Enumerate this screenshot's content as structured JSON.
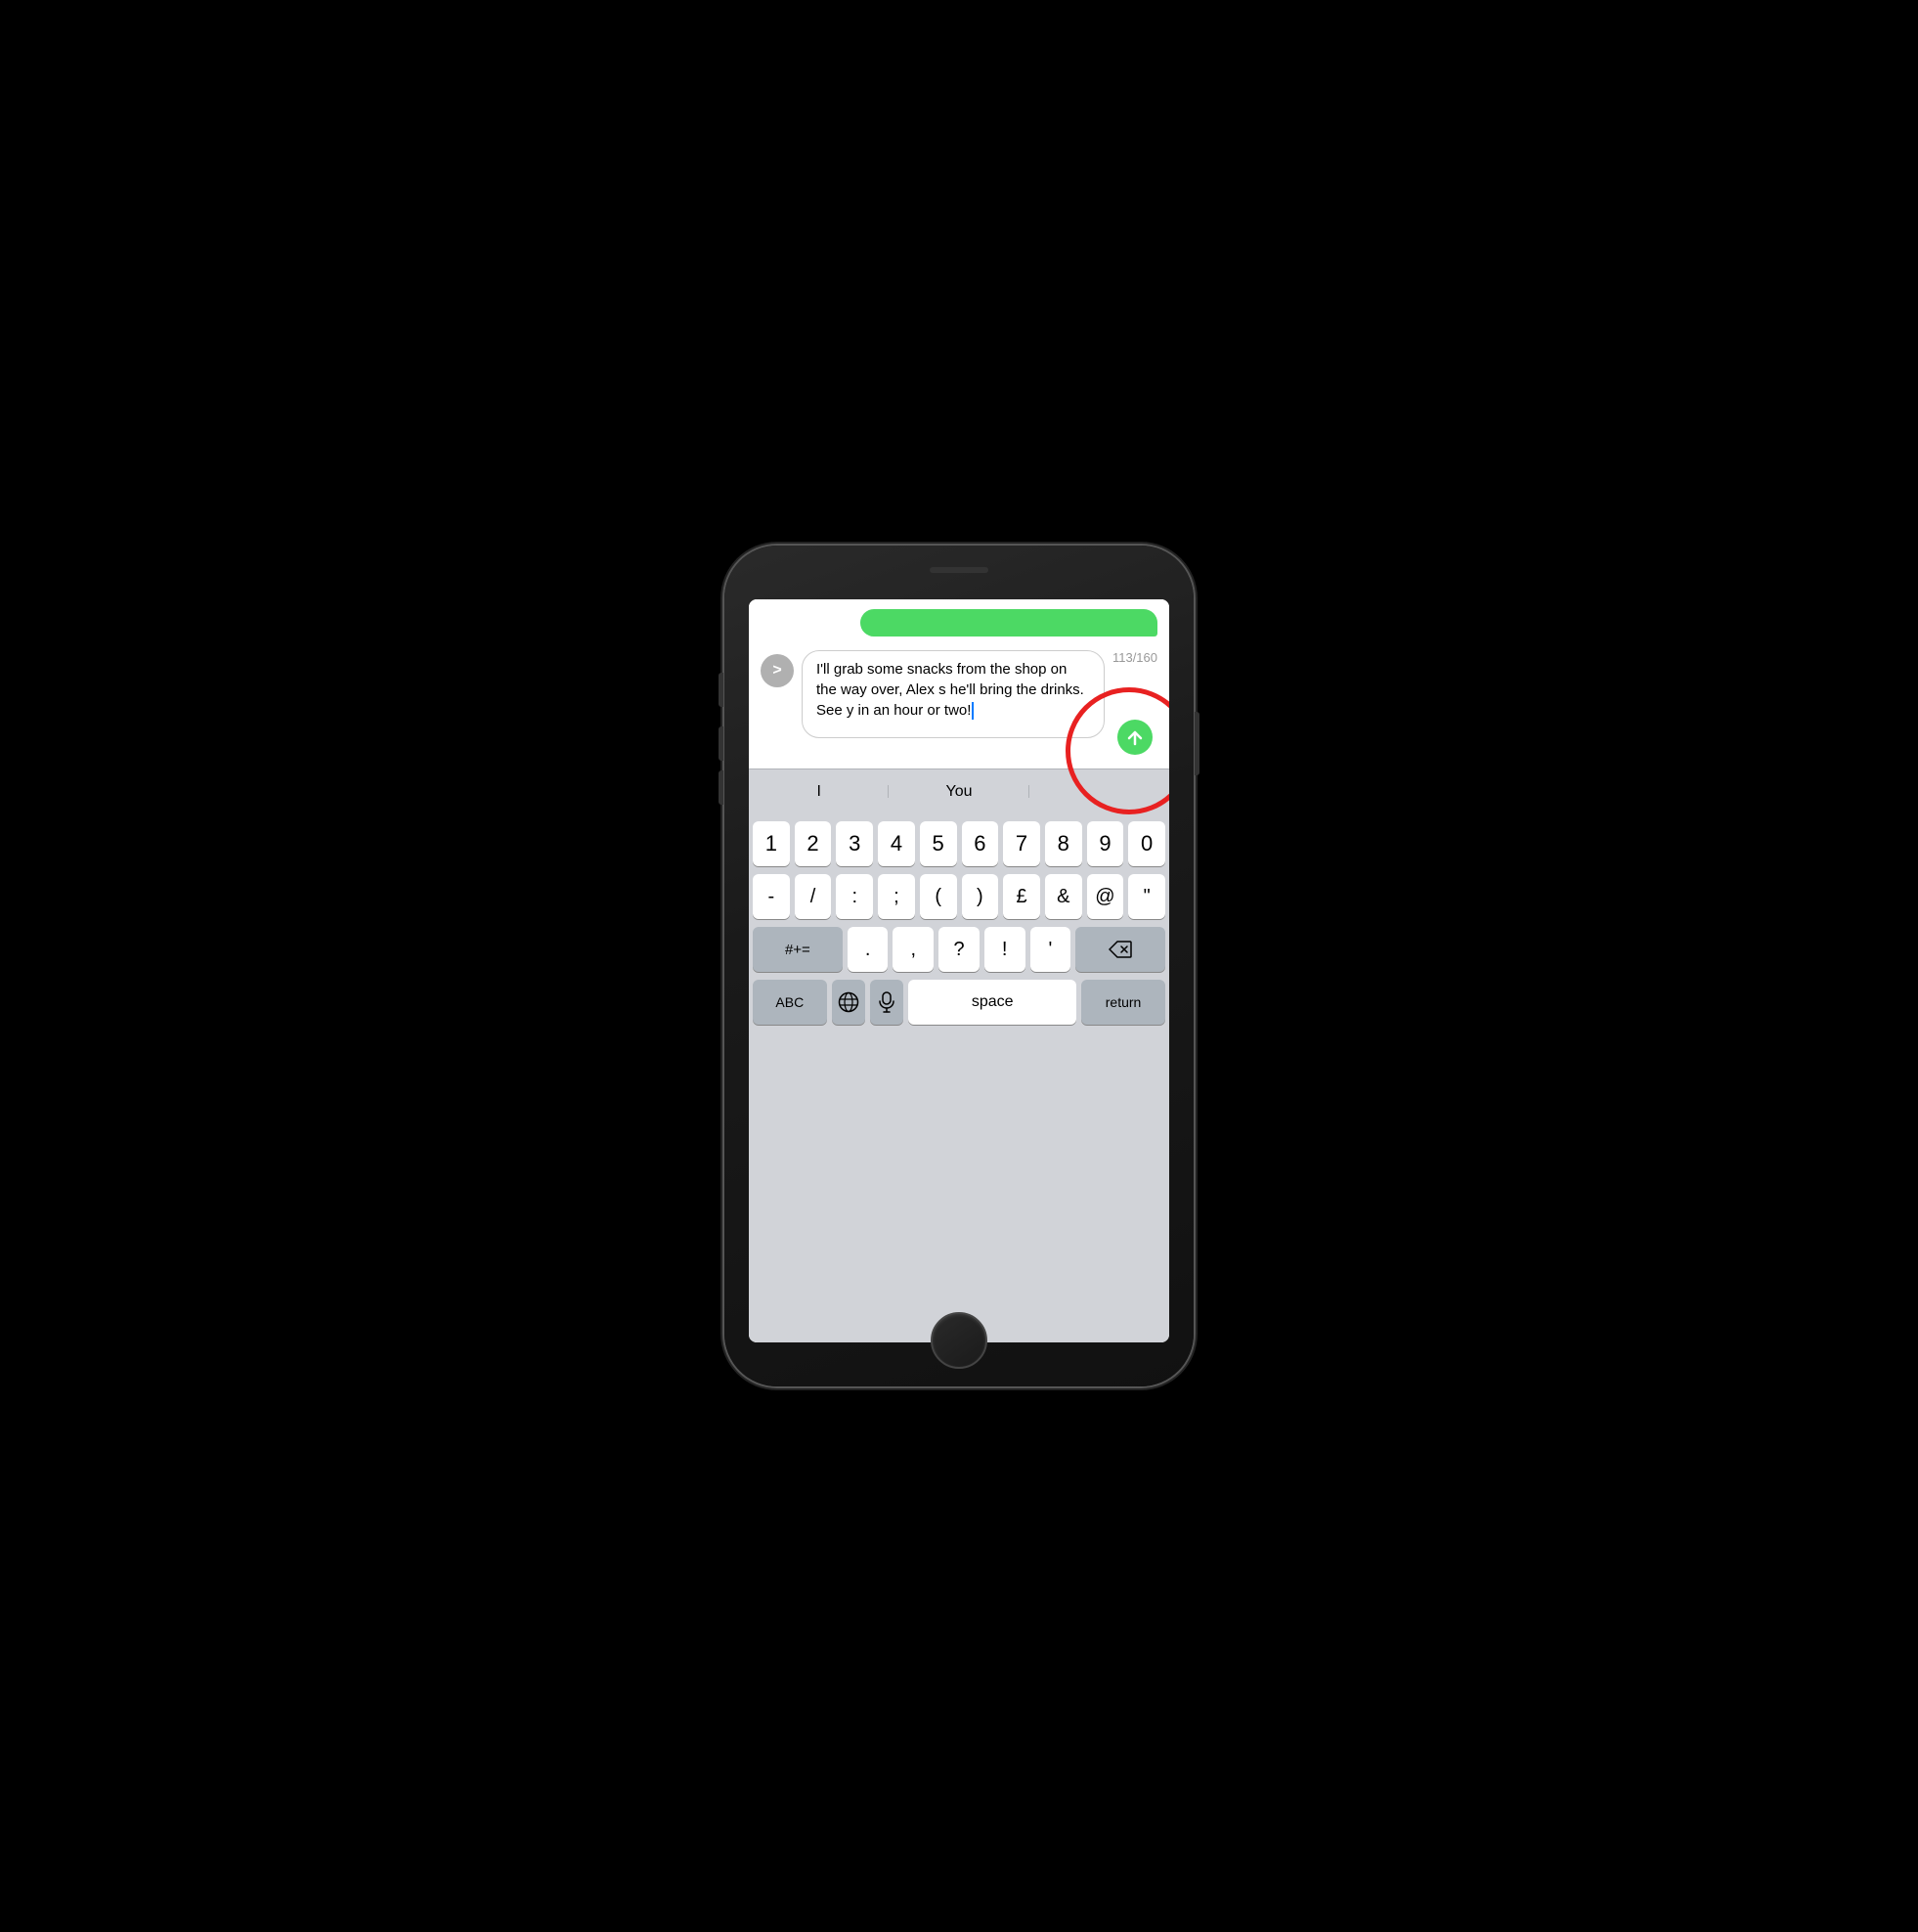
{
  "phone": {
    "screen": {
      "green_bubble_placeholder": "",
      "input": {
        "text": "I'll grab some snacks from the shop on the way over, Alex s he'll bring the drinks. See y in an hour or two!",
        "char_count": "113/160"
      },
      "expand_btn": ">",
      "send_btn_label": "↑",
      "autocomplete": {
        "left": "I",
        "middle": "You",
        "right": ""
      },
      "keyboard": {
        "row1": [
          "1",
          "2",
          "3",
          "4",
          "5",
          "6",
          "7",
          "8",
          "9",
          "0"
        ],
        "row2": [
          "-",
          "/",
          ":",
          ";",
          "(",
          ")",
          "£",
          "&",
          "@",
          "\""
        ],
        "row3_left": "#+=",
        "row3_middle": [
          ".",
          ",",
          "?",
          "!",
          "'"
        ],
        "row3_right": "⌫",
        "row4_left": "ABC",
        "row4_globe": "🌐",
        "row4_mic": "🎤",
        "row4_space": "space",
        "row4_return": "return"
      }
    }
  },
  "annotation": {
    "circle_color": "#e82121"
  }
}
